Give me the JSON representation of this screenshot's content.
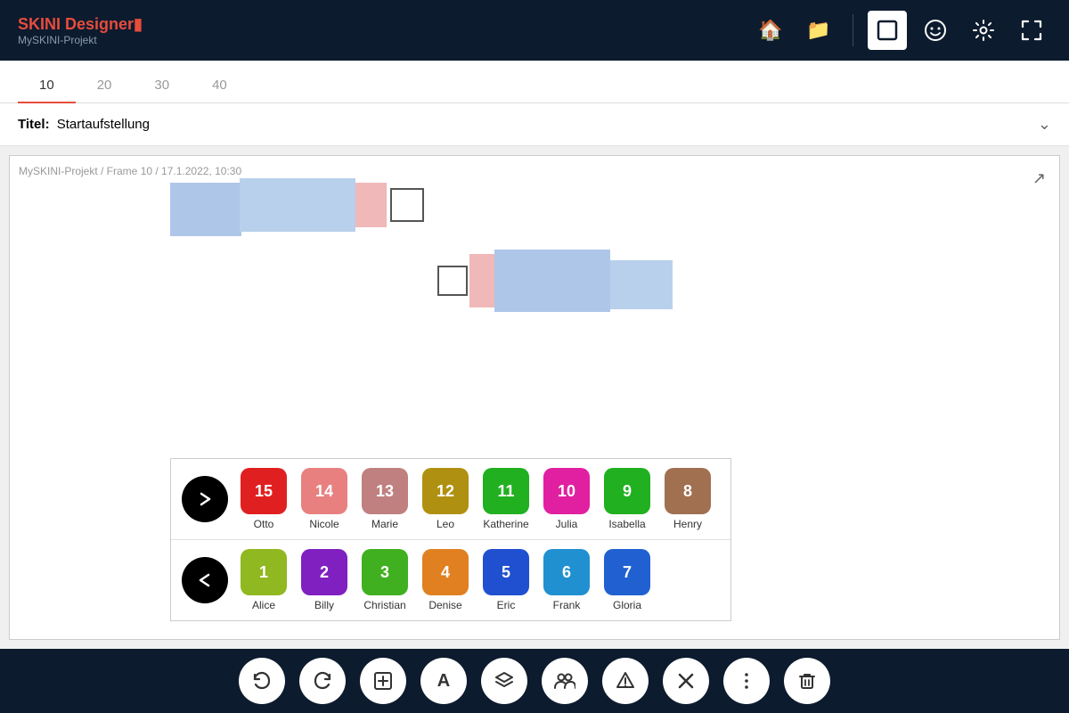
{
  "app": {
    "title": "SKINI Designer",
    "title_accent": "r",
    "subtitle": "MySKINI-Projekt"
  },
  "header": {
    "icons": {
      "home": "🏠",
      "folder": "📁",
      "frame": "⬜",
      "face": "😊",
      "settings": "⚙",
      "fullscreen": "⛶"
    }
  },
  "tabs": [
    {
      "label": "10",
      "active": true
    },
    {
      "label": "20",
      "active": false
    },
    {
      "label": "30",
      "active": false
    },
    {
      "label": "40",
      "active": false
    }
  ],
  "title_bar": {
    "label": "Titel:",
    "value": "Startaufstellung"
  },
  "canvas": {
    "info": "MySKINI-Projekt / Frame 10 / 17.1.2022, 10:30"
  },
  "players_row1": [
    {
      "number": "15",
      "name": "Otto",
      "color": "#e02020"
    },
    {
      "number": "14",
      "name": "Nicole",
      "color": "#e88080"
    },
    {
      "number": "13",
      "name": "Marie",
      "color": "#c08080"
    },
    {
      "number": "12",
      "name": "Leo",
      "color": "#b09010"
    },
    {
      "number": "11",
      "name": "Katherine",
      "color": "#20b020"
    },
    {
      "number": "10",
      "name": "Julia",
      "color": "#e020a0"
    },
    {
      "number": "9",
      "name": "Isabella",
      "color": "#20b020"
    },
    {
      "number": "8",
      "name": "Henry",
      "color": "#a07050"
    }
  ],
  "players_row2": [
    {
      "number": "1",
      "name": "Alice",
      "color": "#90b820"
    },
    {
      "number": "2",
      "name": "Billy",
      "color": "#8020c0"
    },
    {
      "number": "3",
      "name": "Christian",
      "color": "#40b020"
    },
    {
      "number": "4",
      "name": "Denise",
      "color": "#e08020"
    },
    {
      "number": "5",
      "name": "Eric",
      "color": "#2050d0"
    },
    {
      "number": "6",
      "name": "Frank",
      "color": "#2090d0"
    },
    {
      "number": "7",
      "name": "Gloria",
      "color": "#2060d0"
    }
  ],
  "toolbar": {
    "buttons": [
      {
        "name": "undo",
        "icon": "↩"
      },
      {
        "name": "redo",
        "icon": "↪"
      },
      {
        "name": "add-frame",
        "icon": "⊞"
      },
      {
        "name": "text",
        "icon": "A"
      },
      {
        "name": "layers",
        "icon": "◈"
      },
      {
        "name": "players",
        "icon": "👥"
      },
      {
        "name": "filter",
        "icon": "⋀"
      },
      {
        "name": "tools",
        "icon": "✂"
      },
      {
        "name": "more",
        "icon": "⋮"
      },
      {
        "name": "delete",
        "icon": "🗑"
      }
    ]
  }
}
